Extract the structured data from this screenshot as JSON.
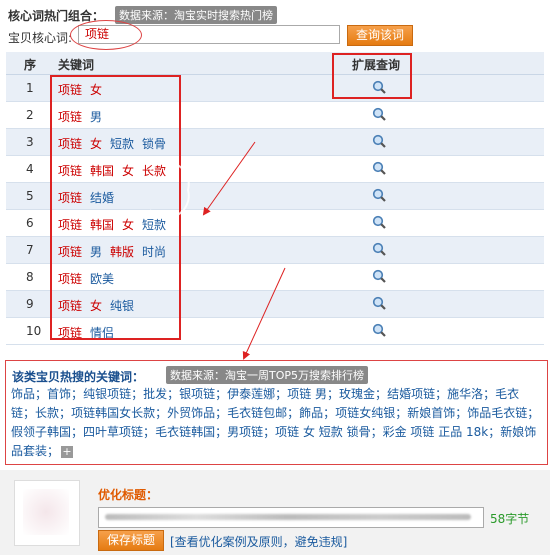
{
  "header": {
    "title": "核心词热门组合：",
    "source_tag": "数据来源：淘宝实时搜索热门榜",
    "keyword_label": "宝贝核心词:",
    "keyword_value": "项链",
    "query_button": "查询该词"
  },
  "table": {
    "columns": [
      "序",
      "关键词",
      "扩展查询"
    ],
    "rows": [
      {
        "no": "1",
        "words": [
          "项链",
          "女"
        ]
      },
      {
        "no": "2",
        "words": [
          "项链",
          "男"
        ]
      },
      {
        "no": "3",
        "words": [
          "项链",
          "女",
          "短款",
          "锁骨"
        ]
      },
      {
        "no": "4",
        "words": [
          "项链",
          "韩国",
          "女",
          "长款"
        ]
      },
      {
        "no": "5",
        "words": [
          "项链",
          "结婚"
        ]
      },
      {
        "no": "6",
        "words": [
          "项链",
          "韩国",
          "女",
          "短款"
        ]
      },
      {
        "no": "7",
        "words": [
          "项链",
          "男",
          "韩版",
          "时尚"
        ]
      },
      {
        "no": "8",
        "words": [
          "项链",
          "欧美"
        ]
      },
      {
        "no": "9",
        "words": [
          "项链",
          "女",
          "纯银"
        ]
      },
      {
        "no": "10",
        "words": [
          "项链",
          "情侣"
        ]
      }
    ],
    "search_icon": "magnifier-icon"
  },
  "hot": {
    "title": "该类宝贝热搜的关键词：",
    "source_tag": "数据来源：淘宝一周TOP5万搜索排行榜",
    "words": [
      "饰品",
      "首饰",
      "纯银项链",
      "批发",
      "银项链",
      "伊泰莲娜",
      "项链 男",
      "玫瑰金",
      "结婚项链",
      "施华洛",
      "毛衣链",
      "长款",
      "项链韩国女长款",
      "外贸饰品",
      "毛衣链包邮",
      "飾品",
      "项链女纯银",
      "新娘首饰",
      "饰品毛衣链",
      "假领子韩国",
      "四叶草项链",
      "毛衣链韩国",
      "男项链",
      "项链 女 短款 锁骨",
      "彩金 项链 正品 18k",
      "新娘饰品套装"
    ],
    "more_icon": "plus-icon",
    "more_label": "+"
  },
  "optimize": {
    "label": "优化标题：",
    "byte_count": "58字节",
    "save_button": "保存标题",
    "help_link": "[查看优化案例及原则，避免违规]"
  },
  "colors": {
    "accent_orange": "#e57b12",
    "keyword_red": "#cc0000",
    "keyword_blue": "#1a5a9e",
    "annotation_red": "#dd2222"
  }
}
